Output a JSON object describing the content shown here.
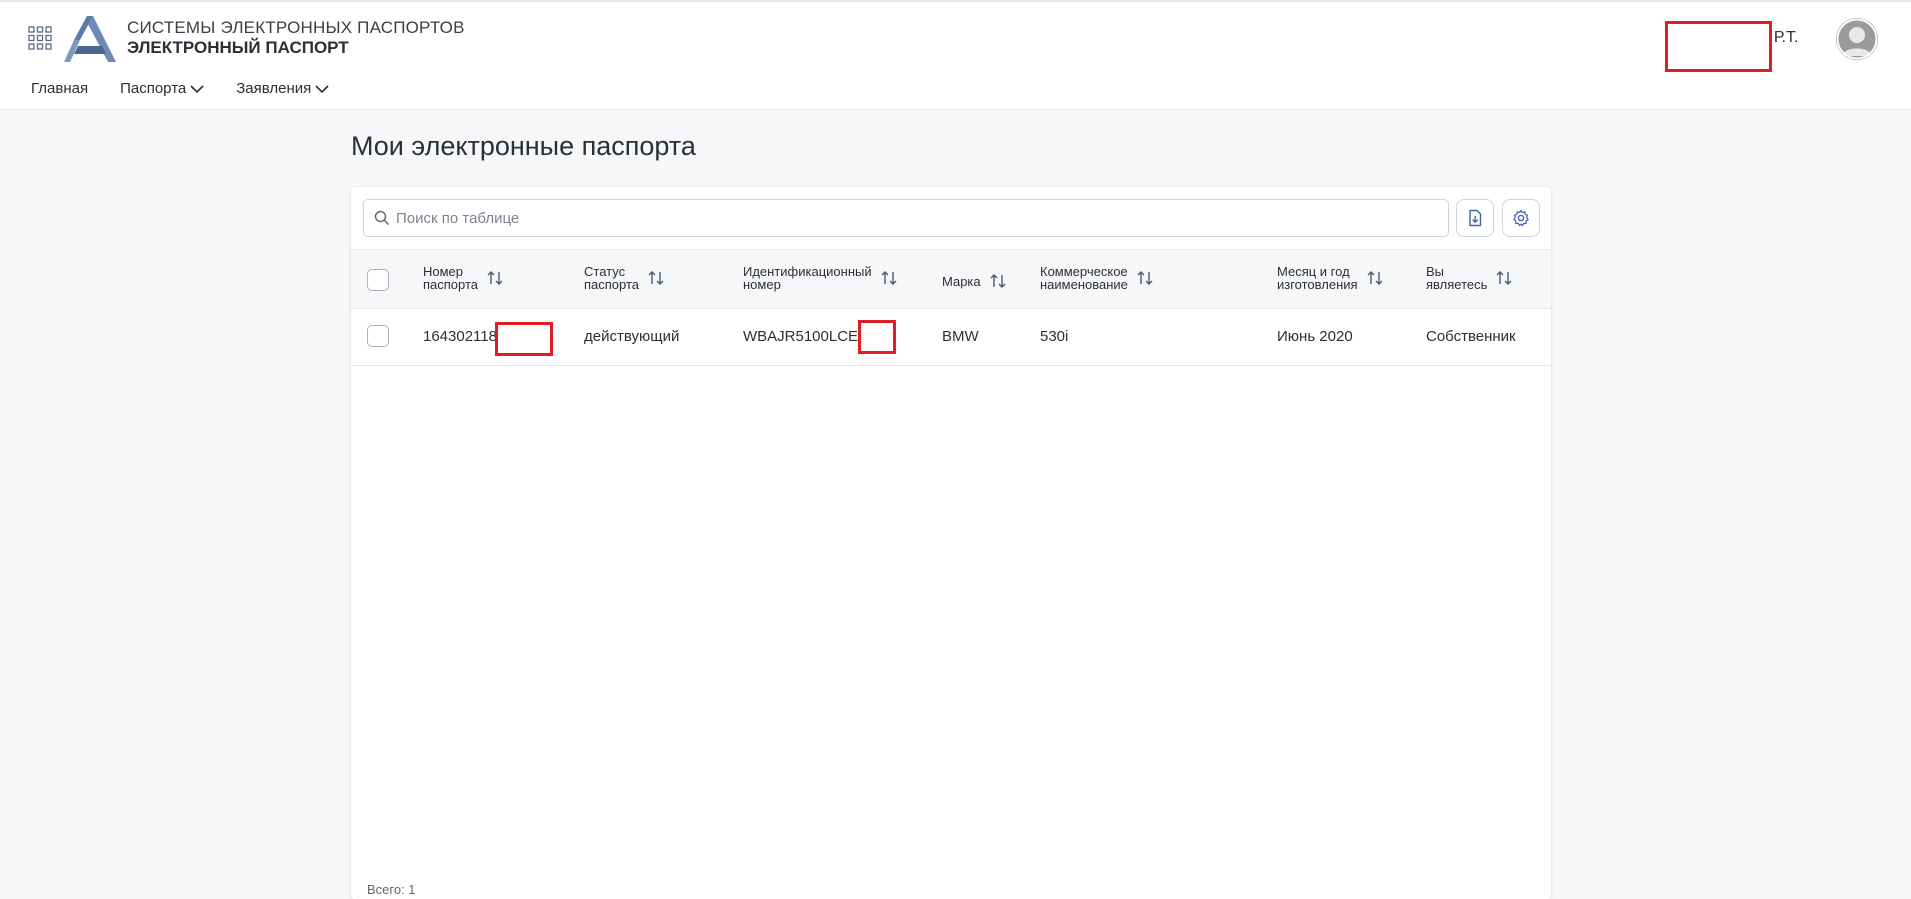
{
  "header": {
    "brand_line1": "СИСТЕМЫ ЭЛЕКТРОННЫХ ПАСПОРТОВ",
    "brand_line2": "ЭЛЕКТРОННЫЙ ПАСПОРТ",
    "user_name": "ов Р.Т.",
    "nav": [
      {
        "label": "Главная",
        "has_dropdown": false
      },
      {
        "label": "Паспорта",
        "has_dropdown": true
      },
      {
        "label": "Заявления",
        "has_dropdown": true
      }
    ]
  },
  "main": {
    "title": "Мои электронные паспорта",
    "search": {
      "placeholder": "Поиск по таблице",
      "value": ""
    },
    "toolbar": {
      "export_icon": "file-download-icon",
      "settings_icon": "gear-icon"
    },
    "columns": [
      "Номер\nпаспорта",
      "Статус\nпаспорта",
      "Идентификационный\nномер",
      "Марка",
      "Коммерческое\nнаименование",
      "Месяц и год\nизготовления",
      "Вы\nявляетесь"
    ],
    "rows": [
      {
        "passport_number": "164302118",
        "status": "действующий",
        "vin": "WBAJR5100LCE8",
        "brand": "BMW",
        "model": "530i",
        "manufacture_date": "Июнь 2020",
        "role": "Собственник"
      }
    ],
    "total": "Всего: 1"
  },
  "colors": {
    "accent": "#5b7aa8",
    "redaction": "#e01e26",
    "background": "#f6f7f9"
  }
}
